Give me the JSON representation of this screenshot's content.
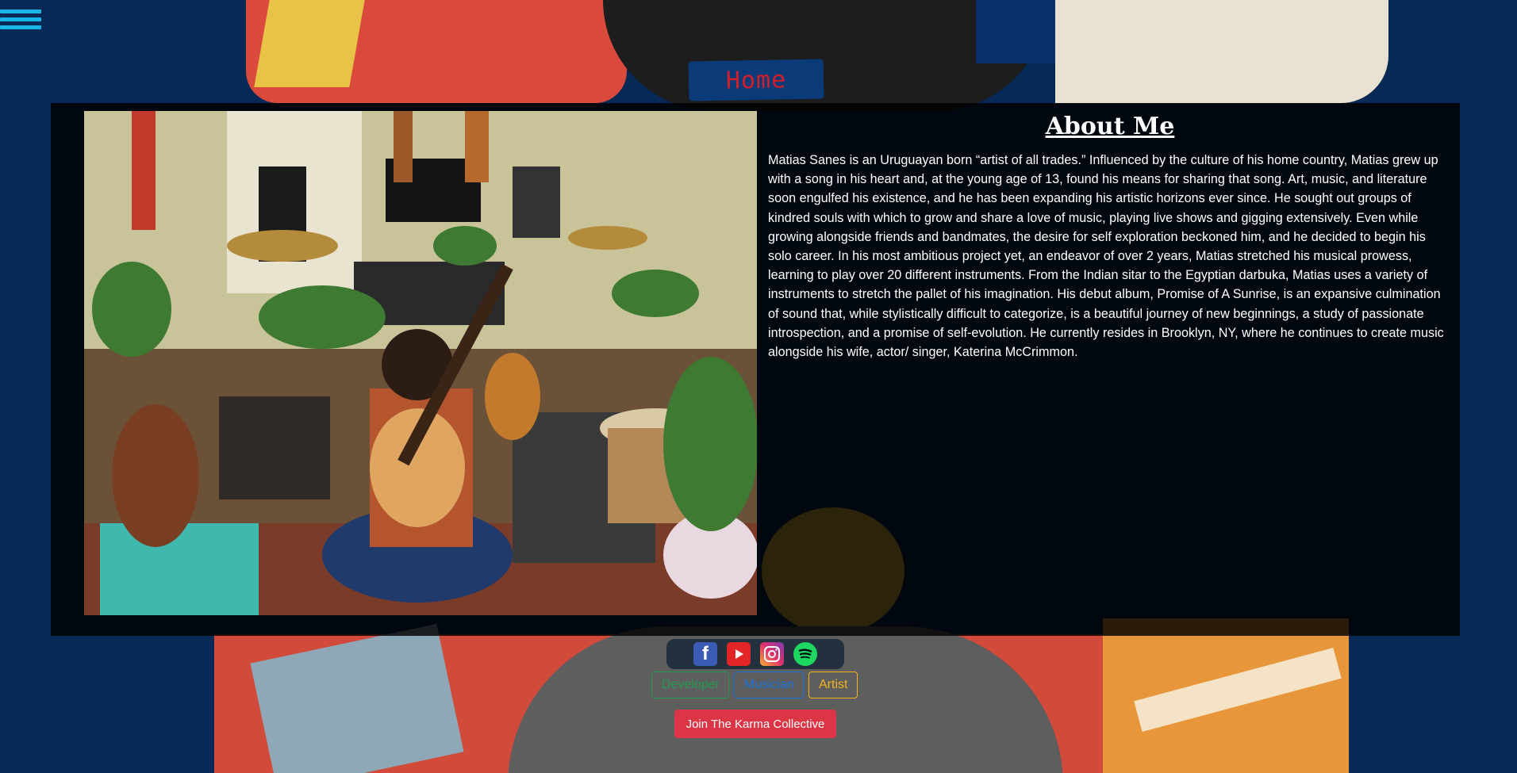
{
  "nav": {
    "home_label": "Home"
  },
  "about": {
    "heading": "About Me",
    "body": "Matias Sanes is an Uruguayan born “artist of all trades.” Influenced by the culture of his home country, Matias grew up with a song in his heart and, at the young age of 13, found his means for sharing that song. Art, music, and literature soon engulfed his existence, and he has been expanding his artistic horizons ever since. He sought out groups of kindred souls with which to grow and share a love of music, playing live shows and gigging extensively. Even while growing alongside friends and bandmates, the desire for self exploration beckoned him, and he decided to begin his solo career. In his most ambitious project yet, an endeavor of over 2 years, Matias stretched his musical prowess, learning to play over 20 different instruments. From the Indian sitar to the Egyptian darbuka, Matias uses a variety of instruments to stretch the pallet of his imagination. His debut album, Promise of A Sunrise, is an expansive culmination of sound that, while stylistically difficult to categorize, is a beautiful journey of new beginnings, a study of passionate introspection, and a promise of self-evolution. He currently resides in Brooklyn, NY, where he continues to create music alongside his wife, actor/ singer, Katerina McCrimmon."
  },
  "social": {
    "facebook_glyph": "f",
    "icons": [
      "facebook-icon",
      "youtube-icon",
      "instagram-icon",
      "spotify-icon"
    ]
  },
  "roles": {
    "developer": "Developer",
    "musician": "Musician",
    "artist": "Artist"
  },
  "cta": {
    "join_label": "Join The Karma Collective"
  },
  "colors": {
    "background": "#062a55",
    "hamburger": "#19b5e8",
    "home_text": "#d21f2b",
    "developer": "#1f9b4f",
    "musician": "#1a73d9",
    "artist": "#f2b51d",
    "join": "#dc3545"
  }
}
